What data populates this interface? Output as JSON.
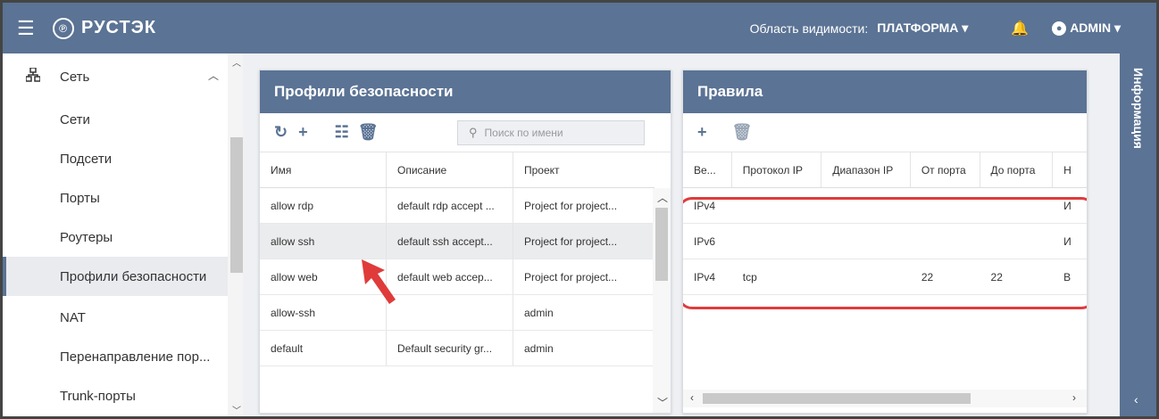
{
  "header": {
    "brand": "РУСТЭК",
    "scope_label": "Область видимости:",
    "scope_value": "ПЛАТФОРМА ▾",
    "user": "ADMIN ▾"
  },
  "sidebar": {
    "section_label": "Сеть",
    "items": [
      {
        "label": "Сети"
      },
      {
        "label": "Подсети"
      },
      {
        "label": "Порты"
      },
      {
        "label": "Роутеры"
      },
      {
        "label": "Профили безопасности",
        "active": true
      },
      {
        "label": "NAT"
      },
      {
        "label": "Перенаправление пор..."
      },
      {
        "label": "Trunk-порты"
      }
    ]
  },
  "profiles": {
    "title": "Профили безопасности",
    "search_placeholder": "Поиск по имени",
    "columns": [
      "Имя",
      "Описание",
      "Проект"
    ],
    "rows": [
      {
        "name": "allow rdp",
        "description": "default rdp accept ...",
        "project": "Project for project..."
      },
      {
        "name": "allow ssh",
        "description": "default ssh accept...",
        "project": "Project for project...",
        "selected": true
      },
      {
        "name": "allow web",
        "description": "default web accep...",
        "project": "Project for project..."
      },
      {
        "name": "allow-ssh",
        "description": "",
        "project": "admin"
      },
      {
        "name": "default",
        "description": "Default security gr...",
        "project": "admin"
      }
    ]
  },
  "rules": {
    "title": "Правила",
    "columns": [
      "Ве...",
      "Протокол IP",
      "Диапазон IP",
      "От порта",
      "До порта",
      "Н"
    ],
    "rows": [
      {
        "version": "IPv4",
        "protocol": "",
        "range": "",
        "from_port": "",
        "to_port": "",
        "direction": "И"
      },
      {
        "version": "IPv6",
        "protocol": "",
        "range": "",
        "from_port": "",
        "to_port": "",
        "direction": "И"
      },
      {
        "version": "IPv4",
        "protocol": "tcp",
        "range": "",
        "from_port": "22",
        "to_port": "22",
        "direction": "В"
      }
    ]
  },
  "info_panel": {
    "label": "Информация"
  },
  "colors": {
    "accent": "#5b7394",
    "highlight": "#e03b3b"
  }
}
